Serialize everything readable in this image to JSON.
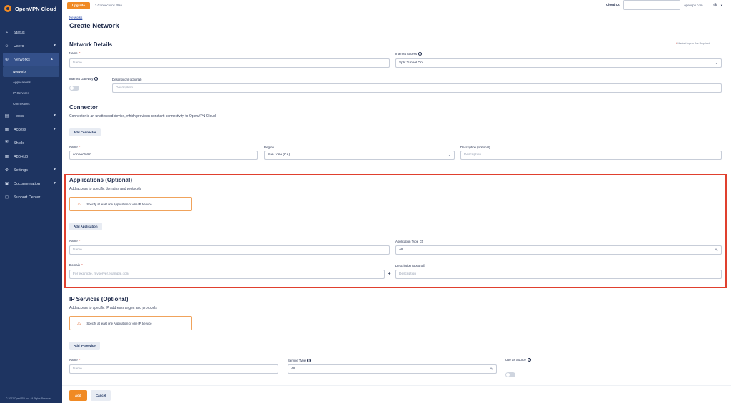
{
  "app": {
    "brand": "OpenVPN Cloud",
    "footer": "© 2022 OpenVPN Inc. All Rights Reserved"
  },
  "colors": {
    "sidebar": "#1e3461",
    "accent": "#f08a24",
    "highlight": "#e0402e"
  },
  "sidebar": {
    "items": [
      {
        "label": "Status",
        "icon": "status-icon"
      },
      {
        "label": "Users",
        "icon": "users-icon"
      },
      {
        "label": "Networks",
        "icon": "networks-icon"
      },
      {
        "label": "Hosts",
        "icon": "hosts-icon"
      },
      {
        "label": "Access",
        "icon": "access-icon"
      },
      {
        "label": "Shield",
        "icon": "shield-icon"
      },
      {
        "label": "AppHub",
        "icon": "apphub-icon"
      },
      {
        "label": "Settings",
        "icon": "settings-icon"
      },
      {
        "label": "Documentation",
        "icon": "documentation-icon"
      },
      {
        "label": "Support Center",
        "icon": "support-icon"
      }
    ],
    "subitems": [
      "Networks",
      "Applications",
      "IP Services",
      "Connectors"
    ]
  },
  "topbar": {
    "upgrade": "Upgrade",
    "plan": "3 Connections Plan",
    "cloud_id_label": "Cloud ID:",
    "cloud_domain": ".openvpn.com"
  },
  "page": {
    "breadcrumb": "Networks",
    "title": "Create Network",
    "marked": "Marked Inputs Are Required"
  },
  "network_details": {
    "title": "Network Details",
    "name_label": "Name",
    "name_placeholder": "Name",
    "internet_access_label": "Internet Access",
    "internet_access_value": "Split Tunnel On",
    "gateway_label": "Internet Gateway",
    "desc_label": "Description (optional)",
    "desc_placeholder": "Description"
  },
  "connector": {
    "title": "Connector",
    "desc": "Connector is an unattended device, which provides constant connectivity to OpenVPN Cloud.",
    "add_button": "Add Connector",
    "name_label": "Name",
    "name_value": "connector01",
    "region_label": "Region",
    "region_value": "San Jose (CA)",
    "desc_label": "Description (optional)",
    "desc_placeholder": "Description"
  },
  "applications": {
    "title": "Applications (Optional)",
    "desc": "Add access to specific domains and protocols",
    "warning": "Specify at least one Application or one IP Service",
    "add_button": "Add Application",
    "name_label": "Name",
    "name_placeholder": "Name",
    "type_label": "Application Type",
    "type_value": "All",
    "domain_label": "Domain",
    "domain_placeholder": "For example, myserver.example.com",
    "desc_label": "Description (optional)",
    "desc_placeholder": "Description",
    "plus": "+"
  },
  "ip_services": {
    "title": "IP Services (Optional)",
    "desc": "Add access to specific IP address ranges and protocols",
    "warning": "Specify at least one Application or one IP Service",
    "add_button": "Add IP Service",
    "name_label": "Name",
    "name_placeholder": "Name",
    "type_label": "Service Type",
    "type_value": "All",
    "source_label": "Use as Source"
  },
  "actions": {
    "add": "Add",
    "cancel": "Cancel"
  }
}
